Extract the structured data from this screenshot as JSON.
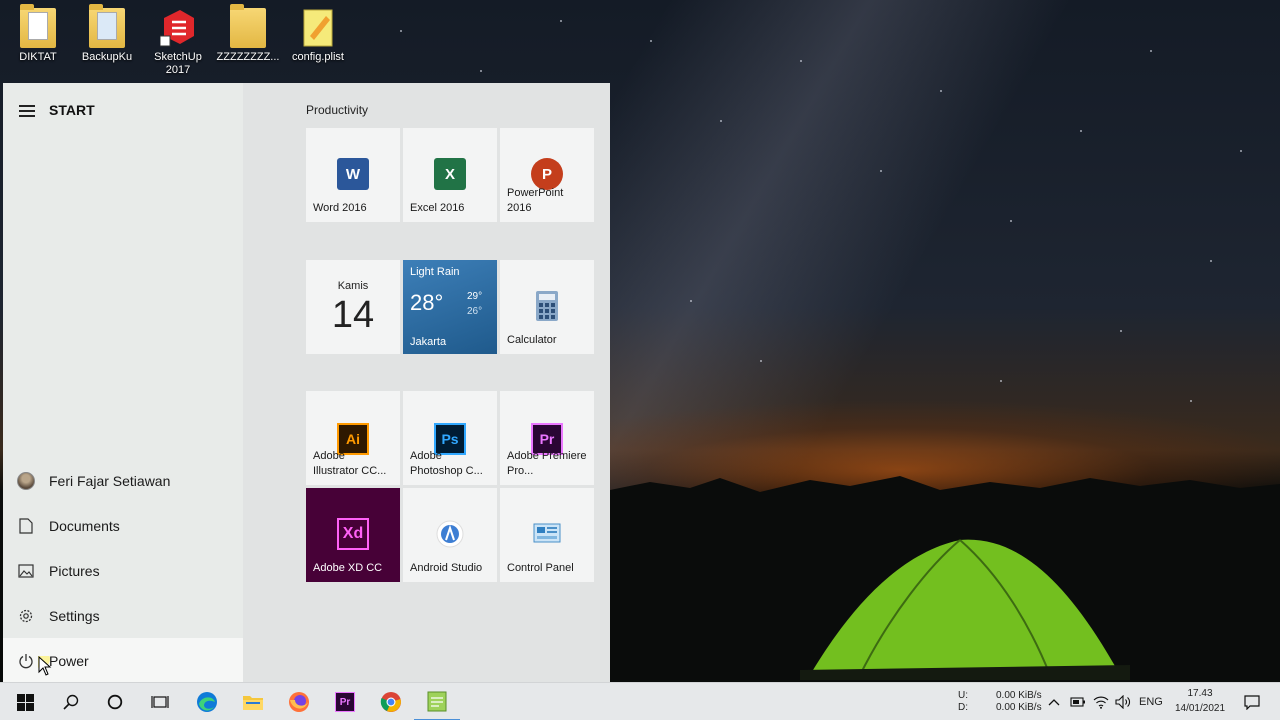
{
  "desktop": {
    "icons": [
      {
        "label": "DIKTAT",
        "icon": "folder-icon"
      },
      {
        "label": "BackupKu",
        "icon": "folder-icon"
      },
      {
        "label": "SketchUp 2017",
        "icon": "sketchup-icon"
      },
      {
        "label": "ZZZZZZZZ...",
        "icon": "folder-icon"
      },
      {
        "label": "config.plist",
        "icon": "notepad-file-icon"
      }
    ]
  },
  "start": {
    "title": "START",
    "left_items": [
      {
        "label": "Feri Fajar Setiawan",
        "icon": "avatar"
      },
      {
        "label": "Documents",
        "icon": "document-icon"
      },
      {
        "label": "Pictures",
        "icon": "pictures-icon"
      },
      {
        "label": "Settings",
        "icon": "gear-icon"
      },
      {
        "label": "Power",
        "icon": "power-icon"
      }
    ],
    "group_title": "Productivity",
    "tiles": {
      "word": {
        "label": "Word 2016",
        "letter": "W"
      },
      "excel": {
        "label": "Excel 2016",
        "letter": "X"
      },
      "powerpoint": {
        "label": "PowerPoint 2016",
        "letter": "P"
      },
      "calendar": {
        "day": "Kamis",
        "date": "14"
      },
      "weather": {
        "condition": "Light Rain",
        "temp": "28°",
        "high": "29°",
        "low": "26°",
        "city": "Jakarta"
      },
      "calculator": {
        "label": "Calculator"
      },
      "illustrator": {
        "label": "Adobe Illustrator CC...",
        "letter": "Ai"
      },
      "photoshop": {
        "label": "Adobe Photoshop C...",
        "letter": "Ps"
      },
      "premiere": {
        "label": "Adobe Premiere Pro...",
        "letter": "Pr"
      },
      "xd": {
        "label": "Adobe XD CC",
        "letter": "Xd"
      },
      "android_studio": {
        "label": "Android Studio"
      },
      "control_panel": {
        "label": "Control Panel"
      }
    }
  },
  "tray": {
    "upload_label": "U:",
    "download_label": "D:",
    "upload_speed": "0.00 KiB/s",
    "download_speed": "0.00 KiB/s",
    "language": "ENG",
    "time": "17.43",
    "date": "14/01/2021"
  },
  "colors": {
    "word": "#2b579a",
    "excel": "#217346",
    "powerpoint": "#c43e1c",
    "weather_tile": "#2c6aa0",
    "xd_tile": "#470137",
    "xd_accent": "#ff61f6",
    "illustrator": "#ff9a00",
    "photoshop": "#31a8ff",
    "premiere": "#ea77ff"
  }
}
